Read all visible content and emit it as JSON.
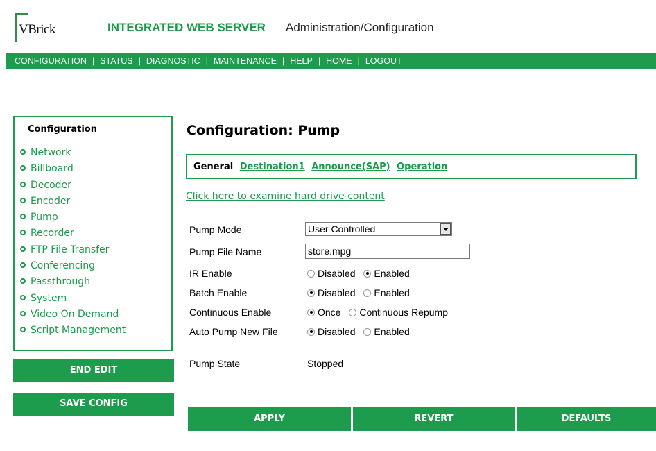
{
  "header": {
    "logo_text": "VBrick",
    "title": "INTEGRATED WEB SERVER",
    "subtitle": "Administration/Configuration"
  },
  "nav": {
    "items": [
      "CONFIGURATION",
      "STATUS",
      "DIAGNOSTIC",
      "MAINTENANCE",
      "HELP",
      "HOME",
      "LOGOUT"
    ],
    "separator": "|"
  },
  "sidebar": {
    "title": "Configuration",
    "items": [
      {
        "label": "Network"
      },
      {
        "label": "Billboard"
      },
      {
        "label": "Decoder"
      },
      {
        "label": "Encoder"
      },
      {
        "label": "Pump"
      },
      {
        "label": "Recorder"
      },
      {
        "label": "FTP File Transfer"
      },
      {
        "label": "Conferencing"
      },
      {
        "label": "Passthrough"
      },
      {
        "label": "System"
      },
      {
        "label": "Video On Demand"
      },
      {
        "label": "Script Management"
      }
    ],
    "end_edit_label": "END EDIT",
    "save_config_label": "SAVE CONFIG"
  },
  "main": {
    "title": "Configuration: Pump",
    "tabs": {
      "current": "General",
      "links": [
        "Destination1",
        "Announce(SAP)",
        "Operation"
      ]
    },
    "hard_drive_link": "Click here to examine hard drive content",
    "form": {
      "pump_mode": {
        "label": "Pump Mode",
        "value": "User Controlled"
      },
      "pump_file_name": {
        "label": "Pump File Name",
        "value": "store.mpg"
      },
      "ir_enable": {
        "label": "IR Enable",
        "options": [
          "Disabled",
          "Enabled"
        ],
        "selected": "Enabled"
      },
      "batch_enable": {
        "label": "Batch Enable",
        "options": [
          "Disabled",
          "Enabled"
        ],
        "selected": "Disabled"
      },
      "continuous_enable": {
        "label": "Continuous Enable",
        "options": [
          "Once",
          "Continuous Repump"
        ],
        "selected": "Once"
      },
      "auto_pump_new_file": {
        "label": "Auto Pump New File",
        "options": [
          "Disabled",
          "Enabled"
        ],
        "selected": "Disabled"
      },
      "pump_state": {
        "label": "Pump State",
        "value": "Stopped"
      }
    },
    "buttons": {
      "apply": "APPLY",
      "revert": "REVERT",
      "defaults": "DEFAULTS"
    }
  },
  "colors": {
    "accent": "#1c9c4c",
    "link": "#1a9a4a"
  }
}
